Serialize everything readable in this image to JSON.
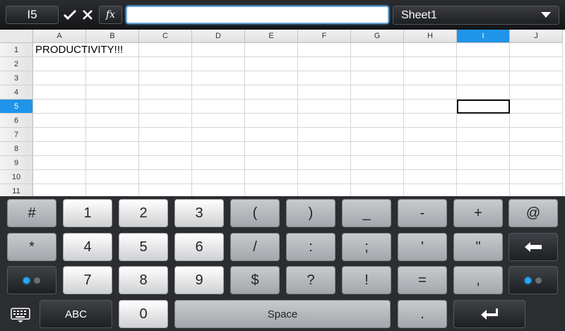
{
  "toolbar": {
    "cell_ref": "I5",
    "formula_value": "",
    "sheet_name": "Sheet1"
  },
  "grid": {
    "columns": [
      "A",
      "B",
      "C",
      "D",
      "E",
      "F",
      "G",
      "H",
      "I",
      "J"
    ],
    "rows": [
      "1",
      "2",
      "3",
      "4",
      "5",
      "6",
      "7",
      "8",
      "9",
      "10",
      "11"
    ],
    "selected_column": "I",
    "selected_row": "5",
    "cell_A1": "PRODUCTIVITY!!!"
  },
  "keyboard": {
    "row1": [
      "#",
      "1",
      "2",
      "3",
      "(",
      ")",
      "_",
      "-",
      "+",
      "@"
    ],
    "row2": [
      "*",
      "4",
      "5",
      "6",
      "/",
      ":",
      ";",
      "'",
      "\""
    ],
    "row3": [
      "7",
      "8",
      "9",
      "$",
      "?",
      "!",
      "=",
      ","
    ],
    "abc_label": "ABC",
    "zero_label": "0",
    "space_label": "Space",
    "dot_label": "."
  },
  "colors": {
    "accent": "#1f94e8",
    "toolbar_bg": "#1d1e21",
    "keyboard_bg": "#2b2d30"
  }
}
